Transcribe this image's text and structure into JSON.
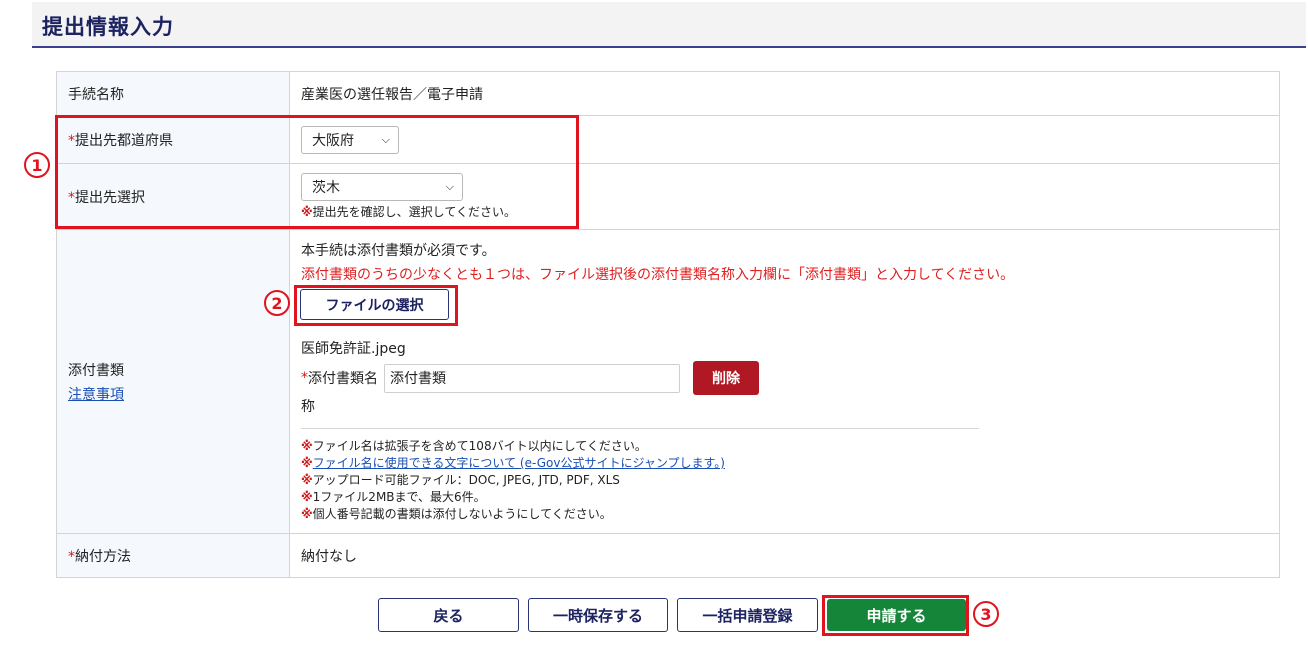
{
  "header": {
    "title": "提出情報入力"
  },
  "rows": {
    "procedure": {
      "label": "手続名称",
      "value": "産業医の選任報告／電子申請"
    },
    "prefecture": {
      "required_mark": "*",
      "label": "提出先都道府県",
      "selected": "大阪府"
    },
    "destination": {
      "required_mark": "*",
      "label": "提出先選択",
      "selected": "茨木",
      "note_mark": "※",
      "note": "提出先を確認し、選択してください。"
    },
    "attachments": {
      "label": "添付書類",
      "notice_link": "注意事項",
      "required_text": "本手続は添付書類が必須です。",
      "instruction": "添付書類のうちの少なくとも１つは、ファイル選択後の添付書類名称入力欄に「添付書類」と入力してください。",
      "file_button": "ファイルの選択",
      "file_name": "医師免許証.jpeg",
      "doc_name_required_mark": "*",
      "doc_name_label": "添付書類名",
      "doc_name_label_wrap": "称",
      "doc_name_value": "添付書類",
      "delete_button": "削除",
      "notes": [
        {
          "mark": "※",
          "text": "ファイル名は拡張子を含めて108バイト以内にしてください。"
        },
        {
          "mark": "※",
          "text": "ファイル名に使用できる文字について (e-Gov公式サイトにジャンプします。)"
        },
        {
          "mark": "※",
          "text": "アップロード可能ファイル：DOC, JPEG, JTD, PDF, XLS"
        },
        {
          "mark": "※",
          "text": "1ファイル2MBまで、最大6件。"
        },
        {
          "mark": "※",
          "text": "個人番号記載の書類は添付しないようにしてください。"
        }
      ]
    },
    "payment": {
      "required_mark": "*",
      "label": "納付方法",
      "value": "納付なし"
    }
  },
  "annotations": {
    "one": "1",
    "two": "2",
    "three": "3"
  },
  "buttons": {
    "back": "戻る",
    "save": "一時保存する",
    "bulk": "一括申請登録",
    "apply": "申請する"
  },
  "colors": {
    "accent": "#1c2360",
    "highlight": "#e0141e",
    "apply": "#15853a",
    "delete": "#b01823"
  }
}
